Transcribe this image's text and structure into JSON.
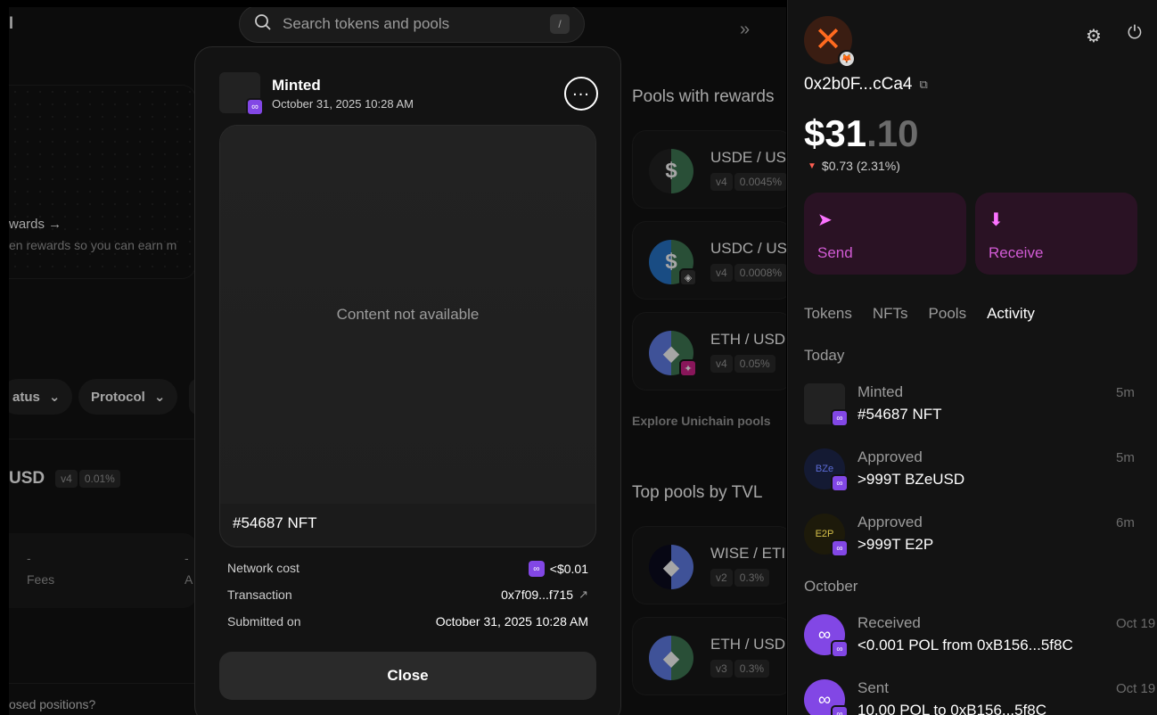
{
  "background": {
    "logo_fragment": "l",
    "rewards_title": "wards →",
    "rewards_subtitle": "en rewards so you can earn m",
    "filters": [
      "atus",
      "Protocol"
    ],
    "pair_fragment": "USD",
    "pair_tags": [
      "v4",
      "0.01%"
    ],
    "stats": [
      {
        "value": "-",
        "label": "Fees"
      },
      {
        "value": "-",
        "label": "A"
      }
    ],
    "closed_positions_text": "osed positions?",
    "search_placeholder": "Search tokens and pools",
    "search_shortcut": "/",
    "pools_with_rewards_title": "Pools with rewards",
    "rewards_pools": [
      {
        "name": "USDE / US",
        "version": "v4",
        "fee": "0.0045%"
      },
      {
        "name": "USDC / US",
        "version": "v4",
        "fee": "0.0008%"
      },
      {
        "name": "ETH / USD",
        "version": "v4",
        "fee": "0.05%"
      }
    ],
    "explore_link": "Explore Unichain pools",
    "top_pools_title": "Top pools by TVL",
    "top_pools": [
      {
        "name": "WISE / ETI",
        "version": "v2",
        "fee": "0.3%"
      },
      {
        "name": "ETH / USD",
        "version": "v3",
        "fee": "0.3%"
      }
    ]
  },
  "modal": {
    "title": "Minted",
    "date": "October 31, 2025 10:28 AM",
    "media_placeholder": "Content not available",
    "nft_label": "#54687 NFT",
    "details": [
      {
        "label": "Network cost",
        "value": "<$0.01"
      },
      {
        "label": "Transaction",
        "value": "0x7f09...f715"
      },
      {
        "label": "Submitted on",
        "value": "October 31, 2025 10:28 AM"
      }
    ],
    "close_label": "Close"
  },
  "wallet": {
    "address": "0x2b0F...cCa4",
    "balance_whole": "$31",
    "balance_decimal": ".10",
    "change": "$0.73 (2.31%)",
    "actions": [
      {
        "label": "Send"
      },
      {
        "label": "Receive"
      }
    ],
    "tabs": [
      "Tokens",
      "NFTs",
      "Pools",
      "Activity"
    ],
    "active_tab": "Activity",
    "groups": {
      "today": "Today",
      "october": "October"
    },
    "activity": [
      {
        "title": "Minted",
        "desc": "#54687 NFT",
        "time": "5m",
        "icon_text": ""
      },
      {
        "title": "Approved",
        "desc": ">999T BZeUSD",
        "time": "5m",
        "icon_text": "BZe"
      },
      {
        "title": "Approved",
        "desc": ">999T E2P",
        "time": "6m",
        "icon_text": "E2P"
      },
      {
        "title": "Received",
        "desc": "<0.001 POL from 0xB156...5f8C",
        "time": "Oct 19",
        "icon_text": ""
      },
      {
        "title": "Sent",
        "desc": "10.00 POL to 0xB156...5f8C",
        "time": "Oct 19",
        "icon_text": ""
      }
    ]
  },
  "colors": {
    "accent_pink": "#fc72ff",
    "polygon_purple": "#8247e5",
    "negative_red": "#ff5f52"
  }
}
